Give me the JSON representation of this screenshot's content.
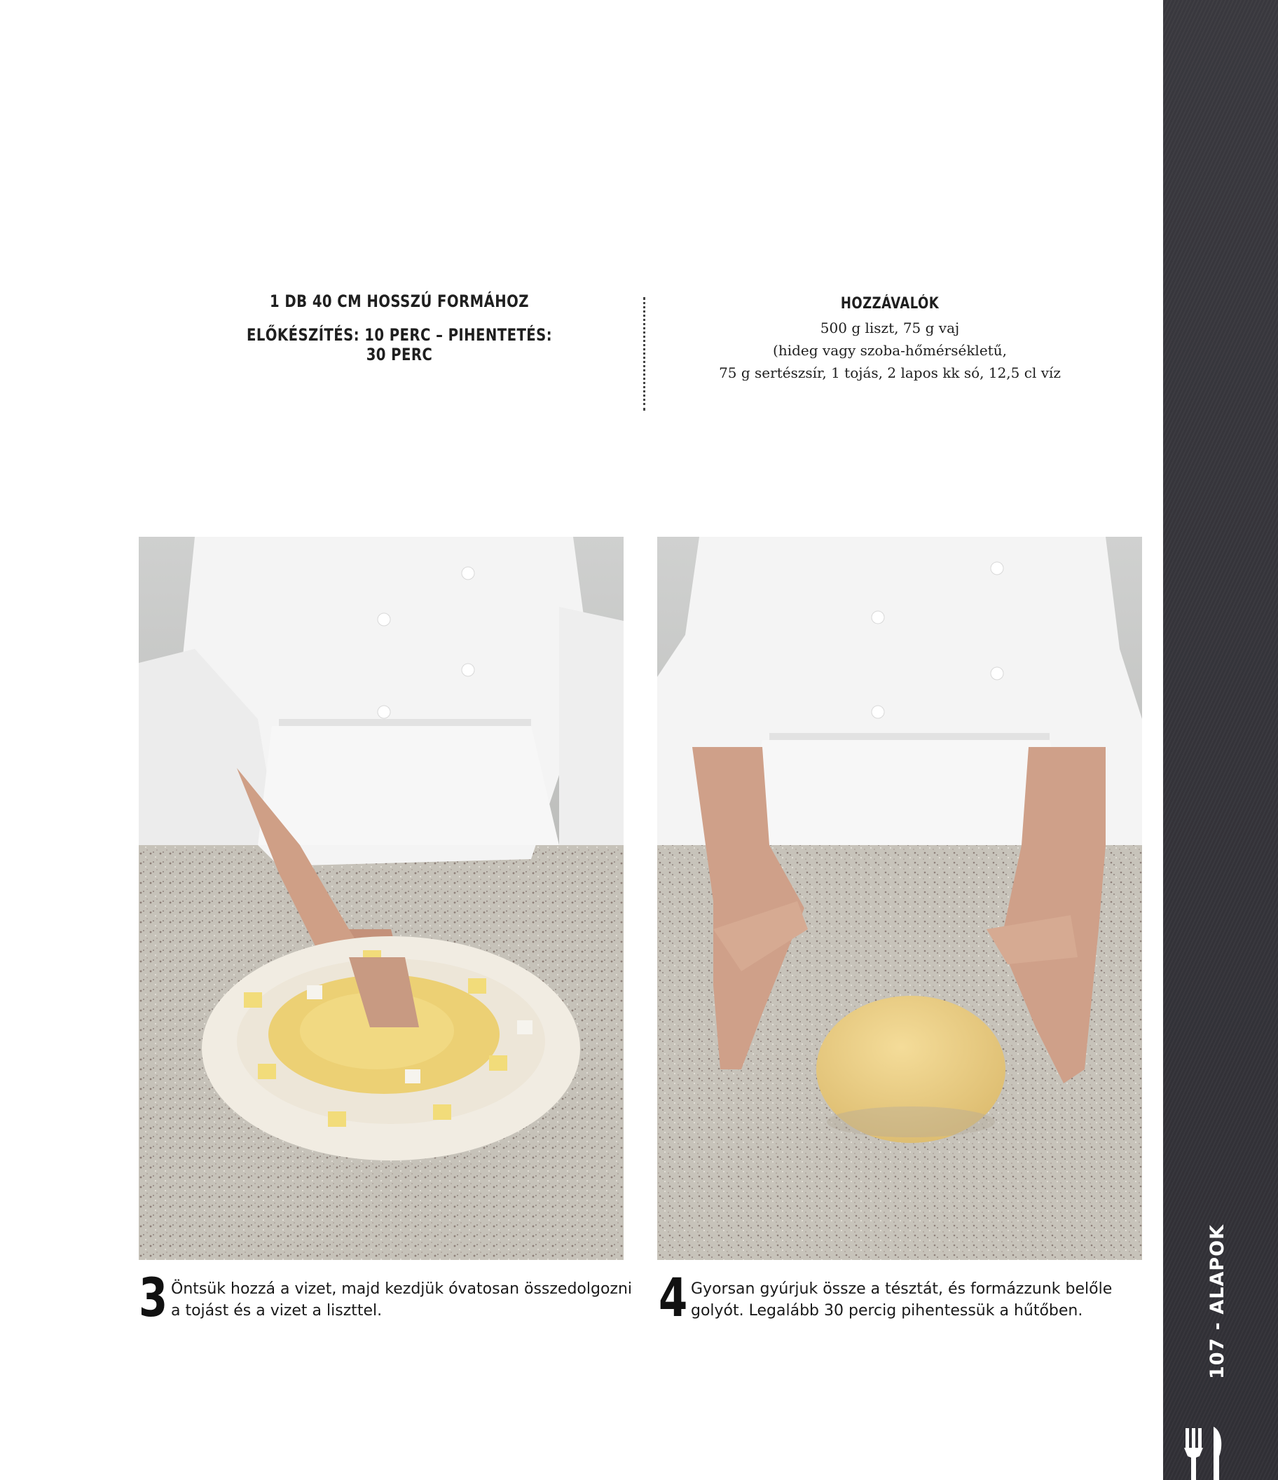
{
  "header": {
    "yield": "1 DB 40 CM HOSSZÚ FORMÁHOZ",
    "timing": "ELŐKÉSZÍTÉS: 10 PERC – PIHENTETÉS: 30 PERC"
  },
  "ingredients": {
    "title": "HOZZÁVALÓK",
    "lines": [
      "500 g liszt, 75 g vaj",
      "(hideg vagy szoba-hőmérsékletű,",
      "75 g sertészsír, 1 tojás, 2 lapos kk só, 12,5 cl víz"
    ]
  },
  "steps": [
    {
      "number": "3",
      "text": "Öntsük hozzá a vizet, majd kezdjük óvatosan összedolgozni a tojást és a vizet a liszttel."
    },
    {
      "number": "4",
      "text": "Gyorsan gyúrjuk össze a tésztát, és formázzunk belőle golyót. Legalább 30 percig pihentessük a hűtőben."
    }
  ],
  "side": {
    "label": "107 - ALAPOK",
    "icon": "fork-knife-icon"
  },
  "colors": {
    "band": "#36353b",
    "counter": "#c9c5bd",
    "jacket": "#f2f2f2",
    "dough": "#ecd18a"
  }
}
